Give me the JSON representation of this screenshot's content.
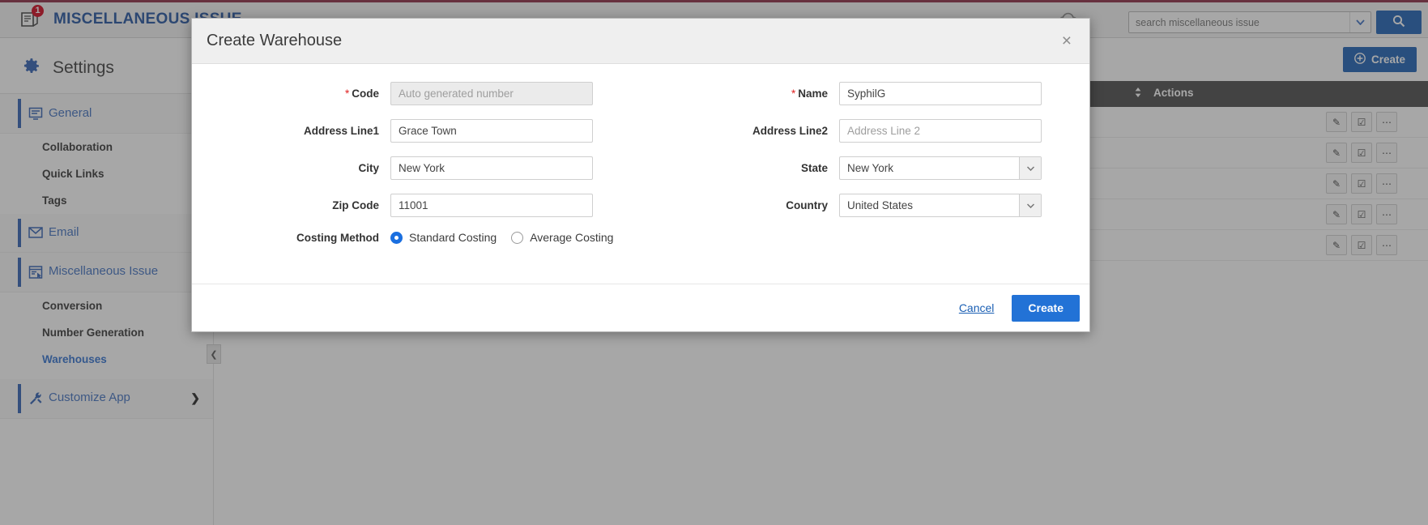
{
  "topbar": {
    "title": "MISCELLANEOUS ISSUE",
    "badge_count": "1",
    "doc_icon": "document-alert-icon",
    "cloud_icon": "cloud-icon",
    "search": {
      "value": "",
      "placeholder": "search miscellaneous issue",
      "caret_icon": "chevron-down-icon",
      "button_icon": "search-icon"
    }
  },
  "sidebar": {
    "header": {
      "label": "Settings",
      "icon": "gear-icon"
    },
    "groups": [
      {
        "label": "General",
        "icon": "monitor-icon",
        "chevron": "chevron-right-icon",
        "children": [
          {
            "label": "Collaboration",
            "active": false
          },
          {
            "label": "Quick Links",
            "active": false
          },
          {
            "label": "Tags",
            "active": false
          }
        ]
      },
      {
        "label": "Email",
        "icon": "envelope-icon",
        "chevron": "chevron-right-icon",
        "children": []
      },
      {
        "label": "Miscellaneous Issue",
        "icon": "form-cursor-icon",
        "chevron": "chevron-down-icon",
        "children": [
          {
            "label": "Conversion",
            "active": false
          },
          {
            "label": "Number Generation",
            "active": false
          },
          {
            "label": "Warehouses",
            "active": true
          }
        ]
      },
      {
        "label": "Customize App",
        "icon": "tools-icon",
        "chevron": "chevron-right-icon",
        "children": []
      }
    ],
    "collapse_icon": "chevron-left-icon"
  },
  "content": {
    "create_button": {
      "label": "Create",
      "icon": "plus-circle-icon"
    },
    "table": {
      "actions_header": "Actions",
      "sort_icon": "sort-icon",
      "row_count": 5,
      "row_action_icons": [
        "edit-pencil-icon",
        "checkbox-check-icon",
        "more-ellipsis-icon"
      ]
    }
  },
  "modal": {
    "title": "Create Warehouse",
    "close_icon": "close-icon",
    "fields_left": [
      {
        "label": "Code",
        "required": true,
        "value": "",
        "placeholder": "Auto generated number",
        "disabled": true,
        "type": "text"
      },
      {
        "label": "Address Line1",
        "required": false,
        "value": "Grace Town",
        "placeholder": "",
        "disabled": false,
        "type": "text"
      },
      {
        "label": "City",
        "required": false,
        "value": "New York",
        "placeholder": "",
        "disabled": false,
        "type": "text"
      },
      {
        "label": "Zip Code",
        "required": false,
        "value": "11001",
        "placeholder": "",
        "disabled": false,
        "type": "text"
      }
    ],
    "fields_right": [
      {
        "label": "Name",
        "required": true,
        "value": "SyphilG",
        "placeholder": "",
        "disabled": false,
        "type": "text"
      },
      {
        "label": "Address Line2",
        "required": false,
        "value": "",
        "placeholder": "Address Line 2",
        "disabled": false,
        "type": "text"
      },
      {
        "label": "State",
        "required": false,
        "value": "New York",
        "placeholder": "",
        "disabled": false,
        "type": "select",
        "caret_icon": "dropdown-caret-icon"
      },
      {
        "label": "Country",
        "required": false,
        "value": "United States",
        "placeholder": "",
        "disabled": false,
        "type": "select",
        "caret_icon": "dropdown-caret-icon"
      }
    ],
    "costing": {
      "label": "Costing Method",
      "options": [
        {
          "label": "Standard Costing",
          "selected": true
        },
        {
          "label": "Average Costing",
          "selected": false
        }
      ]
    },
    "footer": {
      "cancel_label": "Cancel",
      "create_label": "Create"
    }
  },
  "colors": {
    "accent_blue": "#1a5fb4",
    "link_blue": "#2f6fd0",
    "brand_maroon": "#8b2942",
    "badge_red": "#d0021b",
    "required_red": "#e02020",
    "table_header": "#4a4a4a"
  }
}
